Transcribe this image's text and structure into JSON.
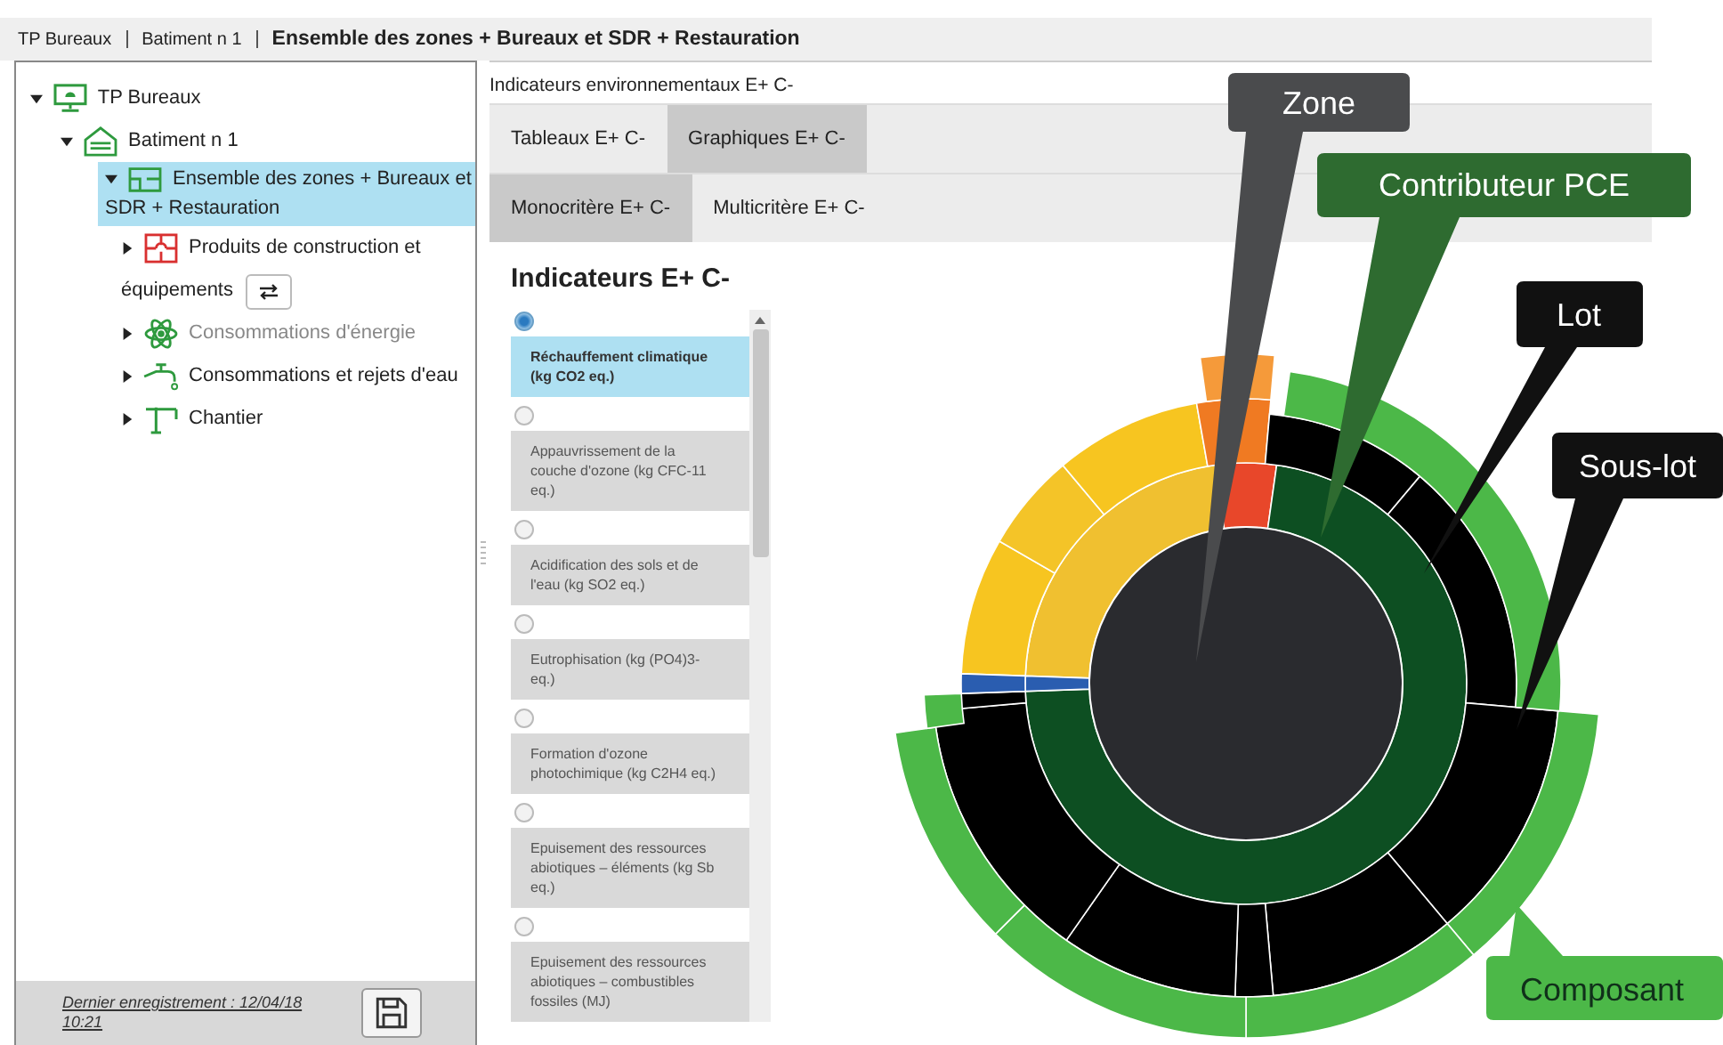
{
  "breadcrumb": [
    {
      "label": "TP Bureaux",
      "current": false
    },
    {
      "label": "Batiment n 1",
      "current": false
    },
    {
      "label": "Ensemble des zones + Bureaux et SDR + Restauration",
      "current": true
    }
  ],
  "tree": [
    {
      "label": "TP Bureaux",
      "kind": "project",
      "expanded": true,
      "selected": false,
      "disabled": false,
      "children": [
        {
          "label": "Batiment n 1",
          "kind": "building",
          "expanded": true,
          "selected": false,
          "disabled": false,
          "children": [
            {
              "label": "Ensemble des zones + Bureaux et SDR + Restauration",
              "kind": "zone",
              "expanded": true,
              "selected": true,
              "disabled": false,
              "children": [
                {
                  "label": "Produits de construction et équipements",
                  "kind": "products",
                  "expanded": false,
                  "selected": false,
                  "disabled": false,
                  "swap_button": true
                },
                {
                  "label": "Consommations d'énergie",
                  "kind": "energy",
                  "expanded": false,
                  "selected": false,
                  "disabled": true
                },
                {
                  "label": "Consommations et rejets d'eau",
                  "kind": "water",
                  "expanded": false,
                  "selected": false,
                  "disabled": false
                },
                {
                  "label": "Chantier",
                  "kind": "site",
                  "expanded": false,
                  "selected": false,
                  "disabled": false
                }
              ]
            }
          ]
        }
      ]
    }
  ],
  "last_save": "Dernier enregistrement : 12/04/18 10:21",
  "panel_title": "Indicateurs environnementaux E+ C-",
  "tabs": [
    {
      "label": "Tableaux E+ C-",
      "selected": false
    },
    {
      "label": "Graphiques E+ C-",
      "selected": true
    }
  ],
  "subtabs": [
    {
      "label": "Monocritère E+ C-",
      "selected": true
    },
    {
      "label": "Multicritère E+ C-",
      "selected": false
    }
  ],
  "indicators_title": "Indicateurs E+ C-",
  "indicators": [
    {
      "label": "Réchauffement climatique (kg CO2 eq.)",
      "selected": true
    },
    {
      "label": "Appauvrissement de la couche d'ozone (kg CFC-11 eq.)",
      "selected": false
    },
    {
      "label": "Acidification des sols et de l'eau (kg SO2 eq.)",
      "selected": false
    },
    {
      "label": "Eutrophisation (kg (PO4)3- eq.)",
      "selected": false
    },
    {
      "label": "Formation d'ozone photochimique (kg C2H4 eq.)",
      "selected": false
    },
    {
      "label": "Epuisement des ressources abiotiques – éléments (kg Sb eq.)",
      "selected": false
    },
    {
      "label": "Epuisement des ressources abiotiques – combustibles fossiles (MJ)",
      "selected": false
    }
  ],
  "callouts": [
    {
      "label": "Zone",
      "color": "#4a4b4d"
    },
    {
      "label": "Contributeur PCE",
      "color": "#2e6b30"
    },
    {
      "label": "Lot",
      "color": "#111111"
    },
    {
      "label": "Sous-lot",
      "color": "#111111"
    },
    {
      "label": "Composant",
      "color": "#4cb848"
    }
  ]
}
